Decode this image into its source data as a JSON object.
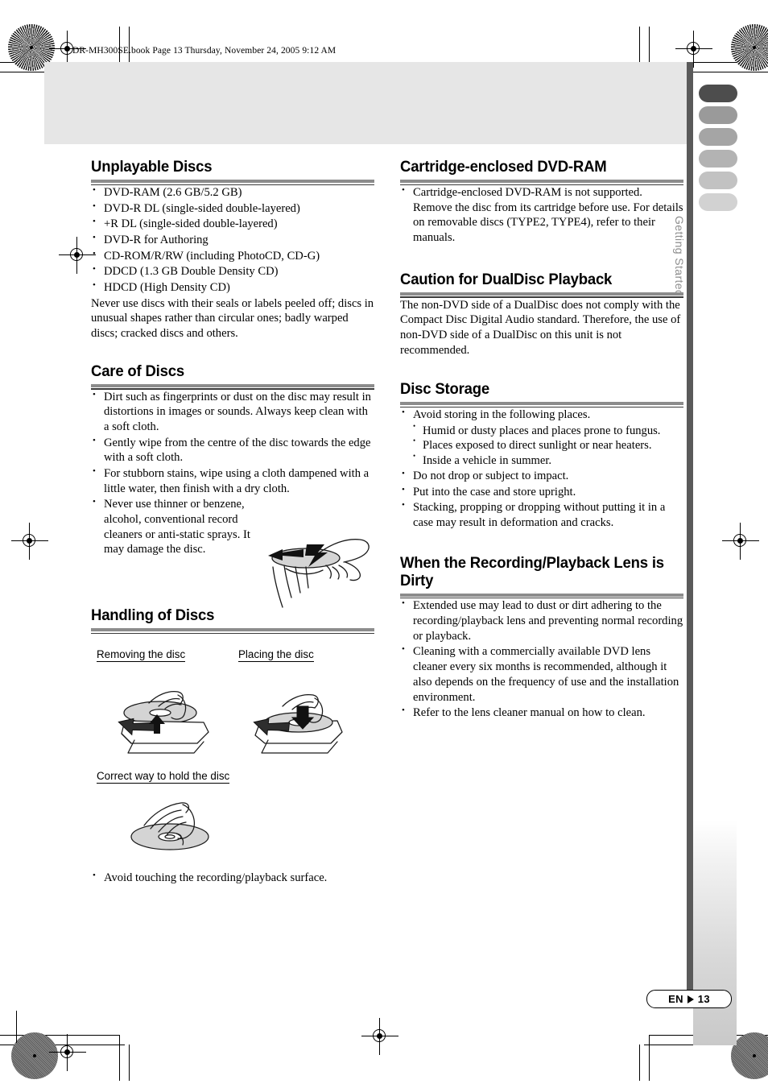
{
  "header": {
    "file_info": "DR-MH300SE.book  Page 13  Thursday, November 24, 2005  9:12 AM"
  },
  "sidebar": {
    "label": "Getting Started",
    "tab_colors": [
      "#4d4d4d",
      "#9a9a9a",
      "#a5a5a5",
      "#b3b3b3",
      "#c2c2c2",
      "#d2d2d2"
    ]
  },
  "footer": {
    "lang": "EN",
    "page": "13"
  },
  "colors": {
    "rule_thick": "#8c8c8c",
    "rule_thin": "#3b3b3b",
    "band": "#e6e6e6",
    "dark_bar": "#5a5a5a",
    "side_label": "#8d8d8d"
  },
  "left_column": {
    "unplayable": {
      "title": "Unplayable Discs",
      "bullets": [
        "DVD-RAM (2.6 GB/5.2 GB)",
        "DVD-R DL (single-sided double-layered)",
        "+R DL (single-sided double-layered)",
        "DVD-R for Authoring",
        "CD-ROM/R/RW (including PhotoCD, CD-G)",
        "DDCD (1.3 GB Double Density CD)",
        "HDCD (High Density CD)"
      ],
      "paragraph": "Never use discs with their seals or labels peeled off; discs in unusual shapes rather than circular ones; badly warped discs; cracked discs and others."
    },
    "care": {
      "title": "Care of Discs",
      "bullets": [
        "Dirt such as fingerprints or dust on the disc may result in distortions in images or sounds. Always keep clean with a soft cloth.",
        "Gently wipe from the centre of the disc towards the edge with a soft cloth.",
        "For stubborn stains, wipe using a cloth dampened with a little water, then finish with a dry cloth.",
        "Never use thinner or benzene, alcohol, conventional record cleaners or anti-static sprays. It may damage the disc."
      ]
    },
    "handling": {
      "title": "Handling of Discs",
      "label_removing": "Removing the disc",
      "label_placing": "Placing the disc",
      "label_hold": "Correct way to hold the disc",
      "bullets": [
        "Avoid touching the recording/playback surface."
      ]
    }
  },
  "right_column": {
    "cartridge": {
      "title": "Cartridge-enclosed DVD-RAM",
      "bullets": [
        "Cartridge-enclosed DVD-RAM is not supported. Remove the disc from its cartridge before use. For details on removable discs (TYPE2, TYPE4), refer to their manuals."
      ]
    },
    "dualdisc": {
      "title": "Caution for DualDisc Playback",
      "paragraph": "The non-DVD side of a DualDisc does not comply with the Compact Disc Digital Audio standard. Therefore, the use of non-DVD side of a DualDisc on this unit is not recommended."
    },
    "storage": {
      "title": "Disc Storage",
      "bullet1": "Avoid storing in the following places.",
      "sub_bullets": [
        "Humid or dusty places and places prone to fungus.",
        "Places exposed to direct sunlight or near heaters.",
        "Inside a vehicle in summer."
      ],
      "bullets_rest": [
        "Do not drop or subject to impact.",
        "Put into the case and store upright.",
        "Stacking, propping or dropping without putting it in a case may result in deformation and cracks."
      ]
    },
    "lens": {
      "title": "When the Recording/Playback Lens is Dirty",
      "bullets": [
        "Extended use may lead to dust or dirt adhering to the recording/playback lens and preventing normal recording or playback.",
        "Cleaning with a commercially available DVD lens cleaner every six months is recommended, although it also depends on the frequency of use and the installation environment.",
        "Refer to the lens cleaner manual on how to clean."
      ]
    }
  }
}
